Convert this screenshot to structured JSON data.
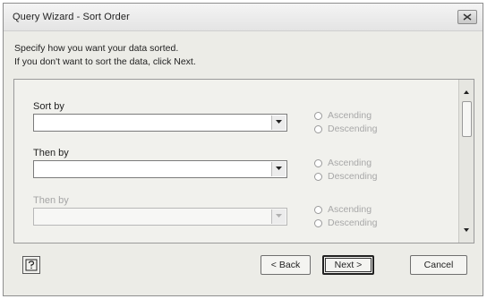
{
  "window": {
    "title": "Query Wizard - Sort Order"
  },
  "instructions": {
    "line1": "Specify how you want your data sorted.",
    "line2": "If you don't want to sort the data, click Next."
  },
  "sort_fields": [
    {
      "label": "Sort by",
      "value": "",
      "enabled": true,
      "ascending": "Ascending",
      "descending": "Descending"
    },
    {
      "label": "Then by",
      "value": "",
      "enabled": true,
      "ascending": "Ascending",
      "descending": "Descending"
    },
    {
      "label": "Then by",
      "value": "",
      "enabled": false,
      "ascending": "Ascending",
      "descending": "Descending"
    }
  ],
  "buttons": {
    "back": "< Back",
    "next": "Next >",
    "cancel": "Cancel"
  },
  "icons": {
    "close": "close-icon",
    "help": "help-icon",
    "dropdown": "chevron-down-icon"
  }
}
